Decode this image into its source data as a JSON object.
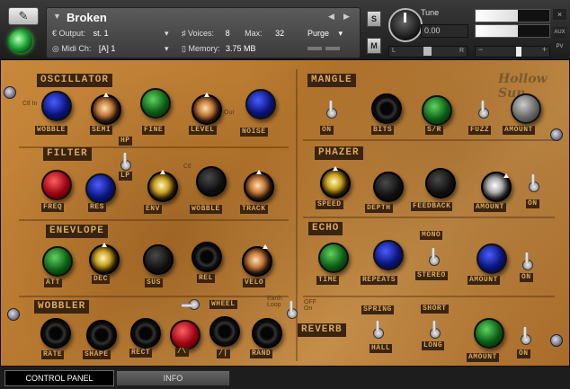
{
  "instrument": {
    "name": "Broken",
    "output_label": "Output:",
    "output_value": "st. 1",
    "midi_label": "Midi Ch:",
    "midi_value": "[A]  1",
    "voices_label": "Voices:",
    "voices_value": "8",
    "max_label": "Max:",
    "max_value": "32",
    "purge_label": "Purge",
    "memory_label": "Memory:",
    "memory_value": "3.75 MB",
    "solo_label": "S",
    "mute_label": "M",
    "tune_label": "Tune",
    "tune_value": "0.00",
    "pan_left": "L",
    "pan_right": "R",
    "aux_label": "AUX",
    "pv_label": "PV"
  },
  "logo_text": "Hollow Sun",
  "sections": {
    "oscillator": "OSCILLATOR",
    "filter": "FILTER",
    "envelope": "ENEVLOPE",
    "wobbler": "WOBBLER",
    "mangle": "MANGLE",
    "phazer": "PHAZER",
    "echo": "ECHO",
    "reverb": "REVERB"
  },
  "labels": {
    "osc_wobble": "WOBBLE",
    "osc_semi": "SEMI",
    "osc_fine": "FINE",
    "osc_level": "LEVEL",
    "osc_noise": "NOISE",
    "osc_ctl_in": "Ctl In",
    "osc_out": "Out",
    "filter_freq": "FREQ",
    "filter_res": "RES",
    "filter_hp": "HP",
    "filter_lp": "LP",
    "filter_env": "ENV",
    "filter_wobble": "WOBBLE",
    "filter_track": "TRACK",
    "filter_ctl": "Ctl",
    "env_att": "ATT",
    "env_dec": "DEC",
    "env_sus": "SUS",
    "env_rel": "REL",
    "env_velo": "VELO",
    "wob_rate": "RATE",
    "wob_shape": "SHAPE",
    "wob_rect": "RECT",
    "wob_tri": "/\\",
    "wob_saw": "/|",
    "wob_rand": "RAND",
    "wob_wheel": "WHEEL",
    "earth_loop": "Earth Loop",
    "off_on": "OFF On",
    "mangle_on": "ON",
    "mangle_bits": "BITS",
    "mangle_sr": "S/R",
    "mangle_fuzz": "FUZZ",
    "mangle_amount": "AMOUNT",
    "phazer_speed": "SPEED",
    "phazer_depth": "DEPTH",
    "phazer_feedback": "FEEDBACK",
    "phazer_amount": "AMOUNT",
    "phazer_on": "ON",
    "echo_time": "TIME",
    "echo_repeats": "REPEATS",
    "echo_mono": "MONO",
    "echo_stereo": "STEREO",
    "echo_amount": "AMOUNT",
    "echo_on": "ON",
    "reverb_spring": "SPRING",
    "reverb_hall": "HALL",
    "reverb_short": "SHORT",
    "reverb_long": "LONG",
    "reverb_amount": "AMOUNT",
    "reverb_on": "ON"
  },
  "tabs": {
    "control_panel": "CONTROL PANEL",
    "info": "INFO"
  },
  "meters": {
    "output_left": 0.57,
    "output_right": 0.57,
    "volume": 0.55
  }
}
